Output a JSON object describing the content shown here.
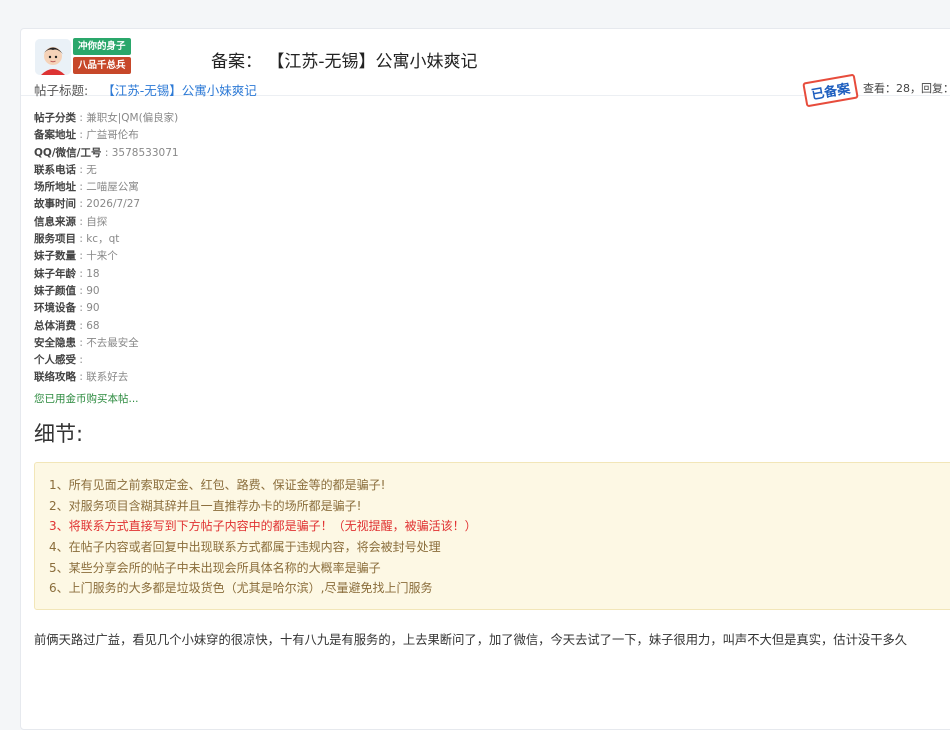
{
  "header": {
    "badge_top": "冲你的身子",
    "badge_bottom": "八品千总兵",
    "title": "备案： 【江苏-无锡】公寓小妹爽记"
  },
  "post": {
    "subject_label": "帖子标题:",
    "subject_value": "【江苏-无锡】公寓小妹爽记",
    "stamp": "已备案",
    "views": "查看：28，回复：",
    "fields": [
      {
        "key": "帖子分类",
        "value": "兼职女|QM(偏良家)"
      },
      {
        "key": "备案地址",
        "value": "广益哥伦布"
      },
      {
        "key": "QQ/微信/工号",
        "value": "3578533071"
      },
      {
        "key": "联系电话",
        "value": "无"
      },
      {
        "key": "场所地址",
        "value": "二喵屋公寓"
      },
      {
        "key": "故事时间",
        "value": "2026/7/27"
      },
      {
        "key": "信息来源",
        "value": "自探"
      },
      {
        "key": "服务项目",
        "value": "kc，qt"
      },
      {
        "key": "妹子数量",
        "value": "十来个"
      },
      {
        "key": "妹子年龄",
        "value": "18"
      },
      {
        "key": "妹子颜值",
        "value": "90"
      },
      {
        "key": "环境设备",
        "value": "90"
      },
      {
        "key": "总体消费",
        "value": "68"
      },
      {
        "key": "安全隐患",
        "value": "不去最安全"
      },
      {
        "key": "个人感受",
        "value": ""
      },
      {
        "key": "联络攻略",
        "value": "联系好去"
      }
    ],
    "bought": "您已用金币购买本帖..."
  },
  "detail": {
    "heading": "细节:",
    "notices": [
      "1、所有见面之前索取定金、红包、路费、保证金等的都是骗子!",
      "2、对服务项目含糊其辞并且一直推荐办卡的场所都是骗子!",
      "3、将联系方式直接写到下方帖子内容中的都是骗子！（无视提醒，被骗活该！）",
      "4、在帖子内容或者回复中出现联系方式都属于违规内容，将会被封号处理",
      "5、某些分享会所的帖子中未出现会所具体名称的大概率是骗子",
      "6、上门服务的大多都是垃圾货色（尤其是哈尔滨）,尽量避免找上门服务"
    ],
    "story": "前俩天路过广益，看见几个小妹穿的很凉快，十有八九是有服务的，上去果断问了，加了微信，今天去试了一下，妹子很用力，叫声不大但是真实，估计没干多久"
  },
  "colors": {
    "link": "#2d7ad6",
    "notice_bg": "#fdf8e4",
    "notice_text": "#8a6d3b",
    "warn": "#e03131",
    "badge_green": "#2aa76b",
    "badge_red": "#c7482a"
  }
}
